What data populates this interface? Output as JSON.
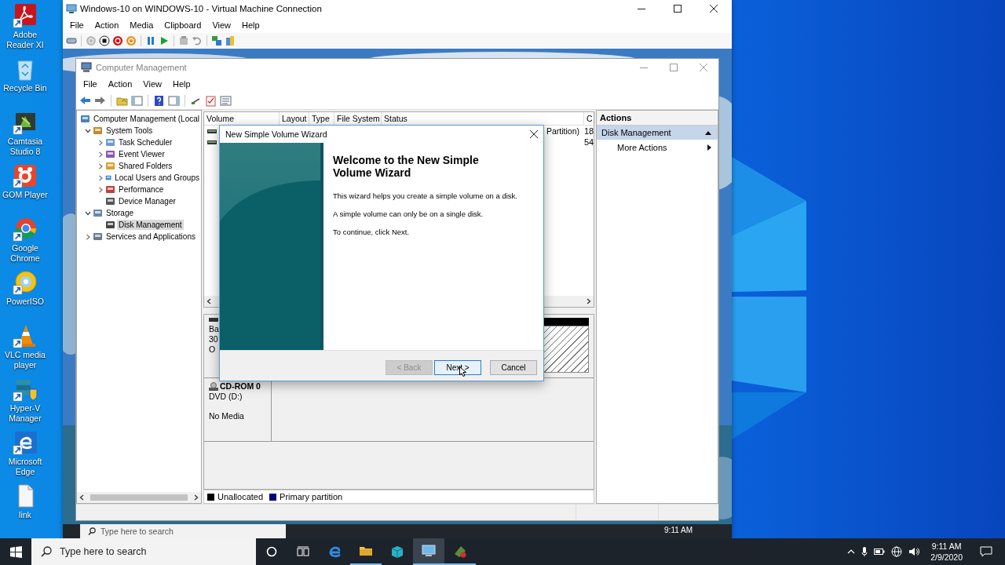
{
  "desktop_icons": [
    {
      "label": "Adobe Reader XI",
      "kind": "pdf",
      "shortcut": true
    },
    {
      "label": "Recycle Bin",
      "kind": "recycle",
      "shortcut": false
    },
    {
      "label": "Camtasia Studio 8",
      "kind": "camtasia",
      "shortcut": true
    },
    {
      "label": "GOM Player",
      "kind": "gom",
      "shortcut": true
    },
    {
      "label": "Google Chrome",
      "kind": "chrome",
      "shortcut": true
    },
    {
      "label": "PowerISO",
      "kind": "disc",
      "shortcut": true
    },
    {
      "label": "VLC media player",
      "kind": "cone",
      "shortcut": true
    },
    {
      "label": "Hyper-V Manager",
      "kind": "hyperv",
      "shortcut": true
    },
    {
      "label": "Microsoft Edge",
      "kind": "edge",
      "shortcut": true
    },
    {
      "label": "link",
      "kind": "file",
      "shortcut": false
    }
  ],
  "vm_window": {
    "title": "Windows-10 on WINDOWS-10 - Virtual Machine Connection",
    "menu": [
      "File",
      "Action",
      "Media",
      "Clipboard",
      "View",
      "Help"
    ]
  },
  "computer_management": {
    "title": "Computer Management",
    "menu": [
      "File",
      "Action",
      "View",
      "Help"
    ],
    "tree": [
      {
        "label": "Computer Management (Local",
        "selected": false,
        "children": [
          {
            "label": "System Tools",
            "expanded": true,
            "selected": false,
            "children": [
              {
                "label": "Task Scheduler",
                "expanded": false,
                "selected": false
              },
              {
                "label": "Event Viewer",
                "expanded": false,
                "selected": false
              },
              {
                "label": "Shared Folders",
                "expanded": false,
                "selected": false
              },
              {
                "label": "Local Users and Groups",
                "expanded": false,
                "selected": false
              },
              {
                "label": "Performance",
                "expanded": false,
                "selected": false
              },
              {
                "label": "Device Manager",
                "selected": false
              }
            ]
          },
          {
            "label": "Storage",
            "expanded": true,
            "selected": false,
            "children": [
              {
                "label": "Disk Management",
                "selected": true
              }
            ]
          },
          {
            "label": "Services and Applications",
            "expanded": false,
            "selected": false
          }
        ]
      }
    ],
    "volume_list": {
      "columns": [
        "Volume",
        "Layout",
        "Type",
        "File System",
        "Status",
        "C"
      ],
      "rows": [
        {
          "status": "Partition)",
          "column_6": "18"
        },
        {
          "column_6": "54"
        }
      ]
    },
    "disks": [
      {
        "kind": "basic",
        "lines": [
          "Ba",
          "30",
          "O"
        ]
      },
      {
        "kind": "cdrom",
        "name": "CD-ROM 0",
        "lines": [
          "DVD (D:)"
        ],
        "status": "No Media"
      }
    ],
    "legend": [
      {
        "label": "Unallocated",
        "color": "#000000"
      },
      {
        "label": "Primary partition",
        "color": "#000080"
      }
    ],
    "actions": {
      "header": "Actions",
      "sections": [
        {
          "label": "Disk Management",
          "expanded": true,
          "items": [
            "More Actions"
          ]
        }
      ]
    }
  },
  "wizard": {
    "title": "New Simple Volume Wizard",
    "heading": "Welcome to the New Simple Volume Wizard",
    "paragraphs": [
      "This wizard helps you create a simple volume on a disk.",
      "A simple volume can only be on a single disk.",
      "To continue, click Next."
    ],
    "buttons": [
      {
        "label": "< Back",
        "disabled": true,
        "default": false
      },
      {
        "label": "Next >",
        "disabled": false,
        "default": true
      },
      {
        "label": "Cancel",
        "disabled": false,
        "default": false
      }
    ]
  },
  "guest_taskbar": {
    "search_placeholder": "Type here to search",
    "time": "9:11 AM"
  },
  "taskbar": {
    "search_placeholder": "Type here to search",
    "apps": [
      {
        "kind": "edge",
        "running": false,
        "active": false
      },
      {
        "kind": "explorer",
        "running": true,
        "active": false
      },
      {
        "kind": "package",
        "running": false,
        "active": false
      },
      {
        "kind": "hyperv",
        "running": true,
        "active": true
      },
      {
        "kind": "tool",
        "running": true,
        "active": false
      }
    ],
    "time": "9:11 AM",
    "date": "2/9/2020"
  }
}
